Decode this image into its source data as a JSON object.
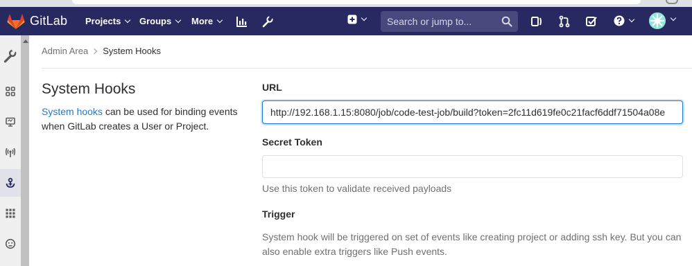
{
  "navbar": {
    "brand": "GitLab",
    "menus": [
      {
        "label": "Projects"
      },
      {
        "label": "Groups"
      },
      {
        "label": "More"
      }
    ],
    "search_placeholder": "Search or jump to...",
    "colors": {
      "background": "#292961",
      "search": "#48487d"
    }
  },
  "sidebar": {
    "items": [
      {
        "icon": "wrench-icon",
        "active": false
      },
      {
        "icon": "overview-grid-icon",
        "active": false
      },
      {
        "icon": "monitor-icon",
        "active": false
      },
      {
        "icon": "broadcast-icon",
        "active": false
      },
      {
        "icon": "system-hooks-anchor-icon",
        "active": true
      },
      {
        "icon": "applications-grid-icon",
        "active": false
      },
      {
        "icon": "abuse-reports-face-icon",
        "active": false
      }
    ]
  },
  "breadcrumb": {
    "parent": "Admin Area",
    "current": "System Hooks"
  },
  "intro": {
    "title": "System Hooks",
    "link_text": "System hooks",
    "description_rest": " can be used for binding events when GitLab creates a User or Project."
  },
  "form": {
    "url_label": "URL",
    "url_value": "http://192.168.1.15:8080/job/code-test-job/build?token=2fc11d619fe0c21facf6ddf71504a08e",
    "secret_label": "Secret Token",
    "secret_value": "",
    "secret_help": "Use this token to validate received payloads",
    "trigger_label": "Trigger",
    "trigger_help": "System hook will be triggered on set of events like creating project or adding ssh key. But you can also enable extra triggers like Push events."
  },
  "accent_color": "#1f78d1"
}
